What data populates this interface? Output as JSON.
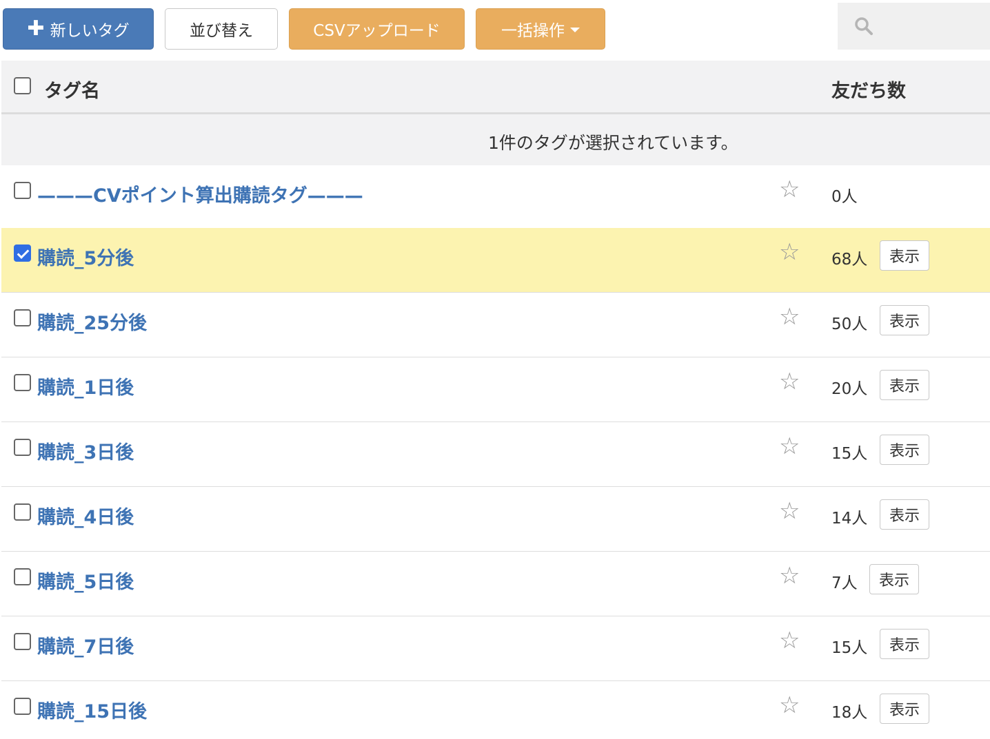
{
  "toolbar": {
    "new_tag_label": "新しいタグ",
    "sort_label": "並び替え",
    "csv_upload_label": "CSVアップロード",
    "bulk_action_label": "一括操作"
  },
  "colors": {
    "primary": "#4a7ab7",
    "warning": "#e9ad5e",
    "link": "#3e73b4",
    "selected_row": "#fcf3b0"
  },
  "table": {
    "header_name": "タグ名",
    "header_count": "友だち数",
    "selection_message": "1件のタグが選択されています。",
    "show_label": "表示",
    "rows": [
      {
        "name": "———CVポイント算出購読タグ———",
        "count": "0人",
        "checked": false,
        "has_show": false
      },
      {
        "name": "購読_5分後",
        "count": "68人",
        "checked": true,
        "has_show": true
      },
      {
        "name": "購読_25分後",
        "count": "50人",
        "checked": false,
        "has_show": true
      },
      {
        "name": "購読_1日後",
        "count": "20人",
        "checked": false,
        "has_show": true
      },
      {
        "name": "購読_3日後",
        "count": "15人",
        "checked": false,
        "has_show": true
      },
      {
        "name": "購読_4日後",
        "count": "14人",
        "checked": false,
        "has_show": true
      },
      {
        "name": "購読_5日後",
        "count": "7人",
        "checked": false,
        "has_show": true
      },
      {
        "name": "購読_7日後",
        "count": "15人",
        "checked": false,
        "has_show": true
      },
      {
        "name": "購読_15日後",
        "count": "18人",
        "checked": false,
        "has_show": true
      }
    ]
  }
}
